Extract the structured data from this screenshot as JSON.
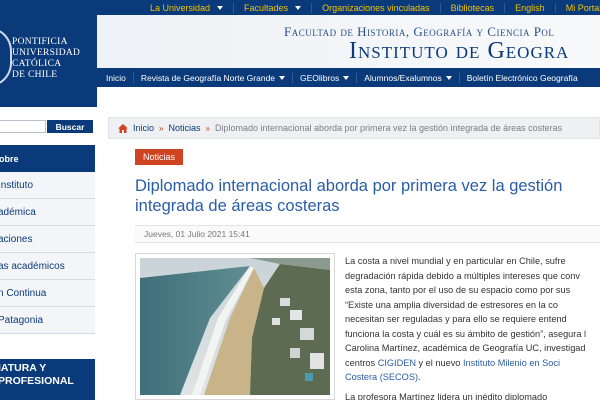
{
  "topnav": {
    "items": [
      {
        "label": "La Universidad",
        "dropdown": true
      },
      {
        "label": "Facultades",
        "dropdown": true
      },
      {
        "label": "Organizaciones vinculadas",
        "dropdown": false
      },
      {
        "label": "Bibliotecas",
        "dropdown": false
      },
      {
        "label": "English",
        "dropdown": false
      },
      {
        "label": "Mi Portal UC",
        "dropdown": false
      }
    ]
  },
  "logo": {
    "line1": "PONTIFICIA",
    "line2": "UNIVERSIDAD",
    "line3": "CATÓLICA",
    "line4": "DE CHILE"
  },
  "banner": {
    "line1": "Facultad de Historia, Geografía y Ciencia Pol",
    "line2": "Instituto de Geogra"
  },
  "mainnav": {
    "items": [
      {
        "label": "Inicio",
        "dropdown": false
      },
      {
        "label": "Revista de Geografía Norte Grande",
        "dropdown": true
      },
      {
        "label": "GEOlibros",
        "dropdown": true
      },
      {
        "label": "Alumnos/Exalumnos",
        "dropdown": true
      },
      {
        "label": "Boletín Electrónico Geografía",
        "dropdown": false
      }
    ]
  },
  "search": {
    "value": "",
    "button_label": "Buscar"
  },
  "sidebar": {
    "header": "obre",
    "items": [
      "Instituto",
      "adémica",
      "aciones",
      "as académicos",
      "n Continua",
      "Patagonia"
    ]
  },
  "promo": {
    "line1": "IATURA Y",
    "line2": "PROFESIONAL"
  },
  "breadcrumb": {
    "items": [
      "Inicio",
      "Noticias"
    ],
    "current": "Diplomado internacional aborda por primera vez la gestión integrada de áreas costeras"
  },
  "article": {
    "category": "Noticias",
    "title_line1": "Diplomado internacional aborda por primera vez la gestión",
    "title_line2": "integrada de áreas costeras",
    "date": "Jueves, 01 Julio 2021 15:41",
    "para1": {
      "l1": "La costa a nivel mundial y en particular en Chile, sufre",
      "l2": "degradación rápida debido a múltiples intereses que conv",
      "l3": "esta zona, tanto por el uso de su espacio como por sus",
      "l4": "“Existe una amplia diversidad de estresores en la co",
      "l5": "necesitan ser reguladas y para ello se requiere entend",
      "l6": "funciona la costa y cuál es su ámbito de gestión”, asegura l",
      "l7": "Carolina Martínez, académica de Geografía UC, investigad",
      "l8_pre": "centros ",
      "link1": "CIGIDEN",
      "l8_mid": " y el nuevo ",
      "link2": "Instituto Milenio en Soci",
      "link2b": "Costera (SECOS)",
      "l9_post": "."
    },
    "para2": "La profesora Martínez lidera un inédito diplomado"
  },
  "colors": {
    "brand_blue": "#0a3a7a",
    "accent_yellow": "#f2c300",
    "badge_red": "#d04521",
    "link_blue": "#2a5da6"
  }
}
